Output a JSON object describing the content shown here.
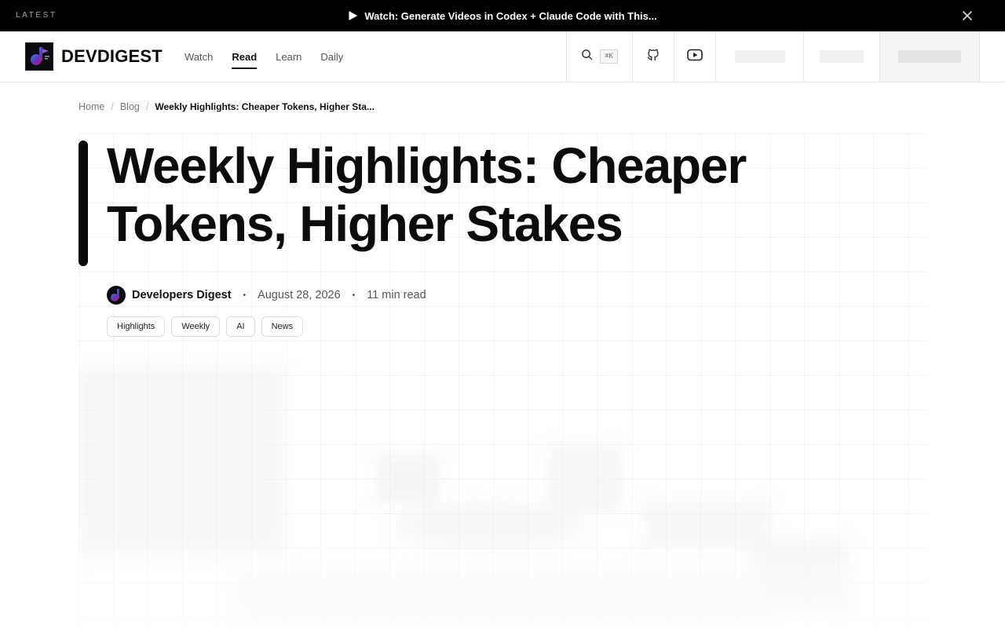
{
  "announcement": {
    "eyebrow": "LATEST",
    "text": "Watch: Generate Videos in Codex + Claude Code with This...",
    "icon": "play-icon",
    "close_icon": "close-icon"
  },
  "header": {
    "brand": "DEVDIGEST",
    "nav": [
      {
        "label": "Watch",
        "active": false
      },
      {
        "label": "Read",
        "active": true
      },
      {
        "label": "Learn",
        "active": false
      },
      {
        "label": "Daily",
        "active": false
      }
    ],
    "search": {
      "icon": "search-icon",
      "shortcut": "⌘K"
    },
    "icons": [
      "github-icon",
      "youtube-icon"
    ]
  },
  "breadcrumb": {
    "items": [
      "Home",
      "Blog"
    ],
    "current": "Weekly Highlights: Cheaper Tokens, Higher Sta..."
  },
  "article": {
    "title": "Weekly Highlights: Cheaper Tokens, Higher Stakes",
    "author": "Developers Digest",
    "date": "August 28, 2026",
    "read_time": "11 min read",
    "separator": "•",
    "tags": [
      "Highlights",
      "Weekly",
      "AI",
      "News"
    ]
  },
  "colors": {
    "announcement_bg": "#000000",
    "accent_bar": "#0a0a0a",
    "text": "#111111",
    "muted": "#555555"
  }
}
